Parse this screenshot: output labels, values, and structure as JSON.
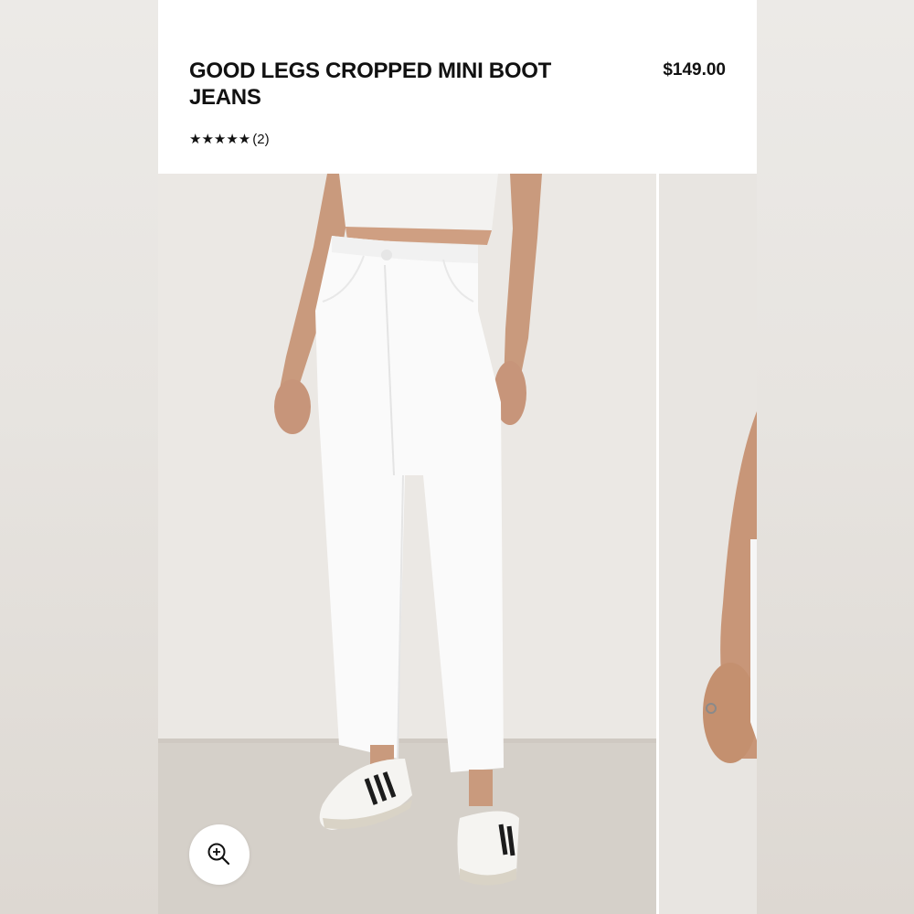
{
  "product": {
    "title": "GOOD LEGS CROPPED MINI BOOT JEANS",
    "price": "$149.00",
    "rating": {
      "value": 5,
      "max": 5,
      "stars_text": "★★★★★",
      "review_count_text": "(2)"
    }
  },
  "gallery": {
    "main_image": "model-wearing-white-cropped-boot-jeans",
    "next_image": "partial-model-hand-with-ring",
    "zoom_icon": "zoom-in-icon"
  },
  "colors": {
    "text": "#111111",
    "card_bg": "#ffffff",
    "backdrop": "#e4e1dd",
    "wall": "#ebe8e4",
    "floor": "#d4cfc8",
    "jeans": "#ffffff"
  }
}
